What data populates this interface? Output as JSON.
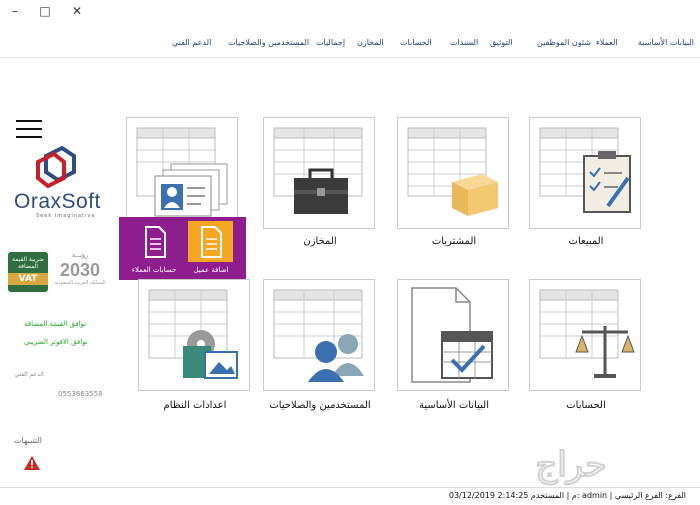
{
  "window": {
    "controls": [
      "–",
      "□",
      "✕"
    ]
  },
  "menu": {
    "items": [
      "البيانات الأساسية",
      "العملاء",
      "شئون الموظفين",
      "التوثيق",
      "السندات",
      "الحسابات",
      "المخازن",
      "إجماليات",
      "المستخدمين والصلاحيات",
      "الدعم الفني"
    ]
  },
  "brand": {
    "name": "OraxSoft",
    "tagline": "Seek Imaginative"
  },
  "badges": {
    "vat_ar": "ضريبة القيمة المضافة",
    "vat_en": "VAT",
    "vision_top": "رؤيـــة",
    "vision_year": "2030",
    "vision_sub": "المملكة العربية السعودية"
  },
  "sidebar": {
    "line1": "نوافق القيمة المضافة",
    "line2": "نوافق الافوتر الضريبي",
    "tech_label": "الدعم الفني",
    "phone": "0553663558",
    "notes_label": "التنبيهات"
  },
  "tiles": {
    "sales": "المبيعات",
    "purchases": "المشتريات",
    "stores": "المخازن",
    "accounts": "الحسابات",
    "basic_data": "البيانات الأساسية",
    "users": "المستخدمين والصلاحيات",
    "settings": "اعدادات النظام"
  },
  "popup": {
    "add_client": "اضافة عميل",
    "client_accounts": "حسابات العملاء"
  },
  "status": {
    "text": "03/12/2019 2:14:25 م | المستخدم: admin | الفرع: الفرع الرئيسي"
  },
  "watermark": {
    "text": "حراج"
  },
  "colors": {
    "accent": "#8e1e8e",
    "popup_icon": "#f5a623",
    "menu_text": "#1f3f7a",
    "green": "#1fa82a"
  }
}
